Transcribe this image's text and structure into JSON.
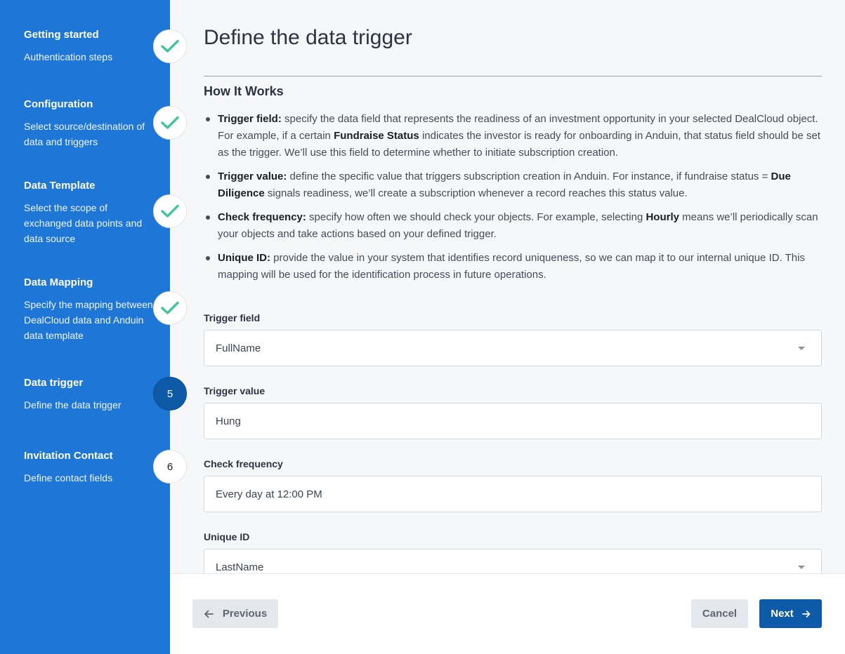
{
  "steps": [
    {
      "title": "Getting started",
      "desc": "Authentication steps",
      "status": "done"
    },
    {
      "title": "Configuration",
      "desc": "Select source/destination of data and triggers",
      "status": "done"
    },
    {
      "title": "Data Template",
      "desc": "Select the scope of exchanged data points and data source",
      "status": "done"
    },
    {
      "title": "Data Mapping",
      "desc": "Specify the mapping between DealCloud data and Anduin data template",
      "status": "done"
    },
    {
      "title": "Data trigger",
      "desc": "Define the data trigger",
      "status": "current",
      "number": "5"
    },
    {
      "title": "Invitation Contact",
      "desc": "Define contact fields",
      "status": "pending",
      "number": "6"
    }
  ],
  "page": {
    "title": "Define the data trigger",
    "section_title": "How It Works"
  },
  "how_it_works": {
    "trigger_field": {
      "term": "Trigger field:",
      "t1": " specify the data field that represents the readiness of an investment opportunity in your selected DealCloud object. For example, if a certain ",
      "b1": "Fundraise Status",
      "t2": " indicates the investor is ready for onboarding in Anduin, that status field should be set as the trigger. We’ll use this field to determine whether to initiate subscription creation."
    },
    "trigger_value": {
      "term": "Trigger value:",
      "t1": " define the specific value that triggers subscription creation in Anduin. For instance, if fundraise status = ",
      "b1": "Due Diligence",
      "t2": " signals readiness, we’ll create a subscription whenever a record reaches this status value."
    },
    "check_frequency": {
      "term": "Check frequency:",
      "t1": " specify how often we should check your objects. For example, selecting ",
      "b1": "Hourly",
      "t2": " means we’ll periodically scan your objects and take actions based on your defined trigger."
    },
    "unique_id": {
      "term": "Unique ID:",
      "t1": " provide the value in your system that identifies record uniqueness, so we can map it to our internal unique ID. This mapping will be used for the identification process in future operations."
    }
  },
  "form": {
    "trigger_field": {
      "label": "Trigger field",
      "value": "FullName"
    },
    "trigger_value": {
      "label": "Trigger value",
      "value": "Hung"
    },
    "check_frequency": {
      "label": "Check frequency",
      "value": "Every day at 12:00 PM"
    },
    "unique_id": {
      "label": "Unique ID",
      "value": "LastName"
    }
  },
  "footer": {
    "previous_label": "Previous",
    "cancel_label": "Cancel",
    "next_label": "Next"
  },
  "colors": {
    "sidebar": "#1e76d6",
    "check": "#3fc79b",
    "primary": "#0d5ba8"
  }
}
